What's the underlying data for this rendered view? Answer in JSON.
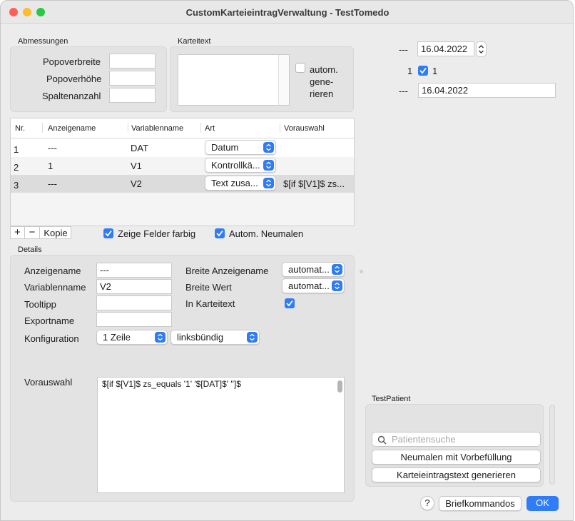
{
  "window": {
    "title": "CustomKarteieintragVerwaltung - TestTomedo"
  },
  "colors": {
    "accent": "#2f7cf6",
    "close": "#ff5f57",
    "minimize": "#febc2e",
    "zoom": "#28c840"
  },
  "abmessungen": {
    "title": "Abmessungen",
    "labels": [
      "Popoverbreite",
      "Popoverhöhe",
      "Spaltenanzahl"
    ],
    "values": [
      "",
      "",
      ""
    ]
  },
  "karteitext": {
    "title": "Karteitext",
    "text": "",
    "autom_label_1": "autom.",
    "autom_label_2": "gene-",
    "autom_label_3": "rieren"
  },
  "preview": {
    "row1_prefix": "---",
    "row1_date": "16.04.2022",
    "row2_prefix": "1",
    "row2_label": "1",
    "row3_prefix": "---",
    "row3_date": "16.04.2022"
  },
  "table": {
    "headers": {
      "nr": "Nr.",
      "anzeigename": "Anzeigename",
      "variablenname": "Variablenname",
      "art": "Art",
      "vorauswahl": "Vorauswahl"
    },
    "rows": [
      {
        "nr": "1",
        "anzeigename": "---",
        "variablenname": "DAT",
        "art": "Datum",
        "vorauswahl": ""
      },
      {
        "nr": "2",
        "anzeigename": "1",
        "variablenname": "V1",
        "art": "Kontrollkä...",
        "vorauswahl": ""
      },
      {
        "nr": "3",
        "anzeigename": "---",
        "variablenname": "V2",
        "art": "Text zusa...",
        "vorauswahl": "$[if $[V1]$ zs..."
      }
    ]
  },
  "table_controls": {
    "add": "+",
    "remove": "−",
    "copy": "Kopie"
  },
  "options": {
    "zeige_felder_farbig": "Zeige Felder farbig",
    "autom_neumalen": "Autom. Neumalen"
  },
  "details": {
    "title": "Details",
    "anzeigename_label": "Anzeigename",
    "anzeigename_value": "---",
    "variablenname_label": "Variablenname",
    "variablenname_value": "V2",
    "tooltipp_label": "Tooltipp",
    "tooltipp_value": "",
    "exportname_label": "Exportname",
    "exportname_value": "",
    "konfiguration_label": "Konfiguration",
    "konfiguration_value": "1 Zeile",
    "ausrichtung_value": "linksbündig",
    "breite_anzeigename_label": "Breite Anzeigename",
    "breite_anzeigename_value": "automat...",
    "breite_wert_label": "Breite Wert",
    "breite_wert_value": "automat...",
    "in_karteitext_label": "In Karteitext",
    "vorauswahl_label": "Vorauswahl",
    "vorauswahl_value": "$[if $[V1]$ zs_equals '1' '$[DAT]$' '']$"
  },
  "test_patient": {
    "title": "TestPatient",
    "search_placeholder": "Patientensuche",
    "neumalen_button": "Neumalen mit Vorbefüllung",
    "generate_button": "Karteieintragstext generieren"
  },
  "footer": {
    "help": "?",
    "briefkommandos": "Briefkommandos",
    "ok": "OK"
  }
}
